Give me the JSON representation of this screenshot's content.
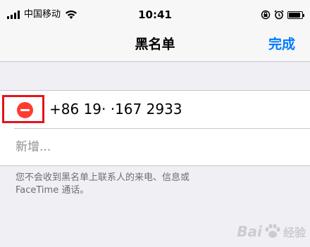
{
  "status_bar": {
    "carrier": "中国移动",
    "time": "10:41",
    "battery_level": 0.9
  },
  "nav": {
    "title": "黑名单",
    "done_label": "完成"
  },
  "blocked": {
    "number": "+86 19·  ·167 2933"
  },
  "add": {
    "label": "新增..."
  },
  "footer": {
    "note_line1": "您不会收到黑名单上联系人的来电、信息或",
    "note_line2": "FaceTime 通话。"
  },
  "watermark": {
    "text_left": "Bai",
    "text_right": "经验"
  },
  "colors": {
    "accent": "#007aff",
    "delete": "#ff3b30",
    "highlight": "#e3141b",
    "background": "#efeff4"
  },
  "icons": [
    "signal-icon",
    "wifi-icon",
    "alarm-icon",
    "orientation-lock-icon",
    "battery-icon",
    "delete-icon",
    "paw-icon"
  ]
}
